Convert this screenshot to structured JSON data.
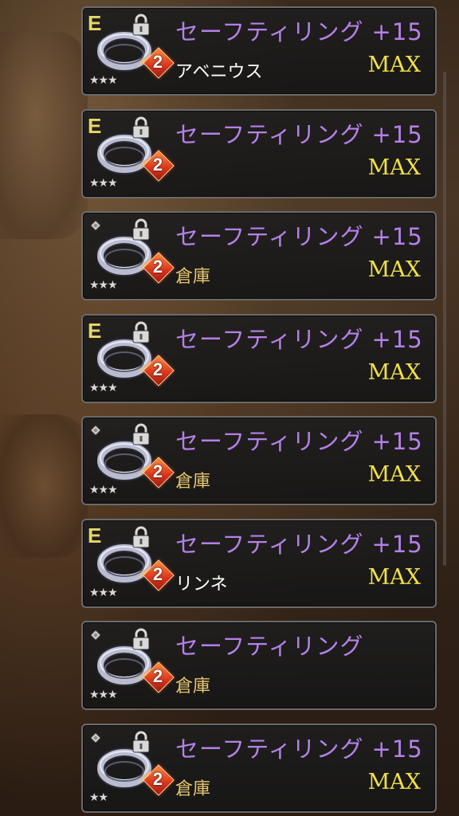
{
  "items": [
    {
      "equipped": true,
      "badge": "E",
      "name": "セーフティリング",
      "plus": "+15",
      "level": "2",
      "stars": "★★★",
      "max": "MAX",
      "location": "アベニウス",
      "location_kind": "character"
    },
    {
      "equipped": true,
      "badge": "E",
      "name": "セーフティリング",
      "plus": "+15",
      "level": "2",
      "stars": "★★★",
      "max": "MAX",
      "location": "",
      "location_kind": "character"
    },
    {
      "equipped": false,
      "badge": "",
      "name": "セーフティリング",
      "plus": "+15",
      "level": "2",
      "stars": "★★★",
      "max": "MAX",
      "location": "倉庫",
      "location_kind": "storage"
    },
    {
      "equipped": true,
      "badge": "E",
      "name": "セーフティリング",
      "plus": "+15",
      "level": "2",
      "stars": "★★★",
      "max": "MAX",
      "location": "",
      "location_kind": "character"
    },
    {
      "equipped": false,
      "badge": "",
      "name": "セーフティリング",
      "plus": "+15",
      "level": "2",
      "stars": "★★★",
      "max": "MAX",
      "location": "倉庫",
      "location_kind": "storage"
    },
    {
      "equipped": true,
      "badge": "E",
      "name": "セーフティリング",
      "plus": "+15",
      "level": "2",
      "stars": "★★★",
      "max": "MAX",
      "location": "リンネ",
      "location_kind": "character"
    },
    {
      "equipped": false,
      "badge": "",
      "name": "セーフティリング",
      "plus": "",
      "level": "2",
      "stars": "★★★",
      "max": "",
      "location": "倉庫",
      "location_kind": "storage"
    },
    {
      "equipped": false,
      "badge": "",
      "name": "セーフティリング",
      "plus": "+15",
      "level": "2",
      "stars": "★★",
      "max": "MAX",
      "location": "倉庫",
      "location_kind": "storage"
    }
  ],
  "colors": {
    "name": "#b580e8",
    "max": "#f2e049",
    "equip_badge": "#e8d76a",
    "storage": "#e8c872",
    "character": "#ffffff",
    "card_border": "#6b6b6b"
  },
  "icons": {
    "equipped": "equipped-e-icon",
    "unequipped": "gem-icon",
    "item": "ring-icon",
    "lock": "lock-icon",
    "level": "level-diamond-icon"
  }
}
